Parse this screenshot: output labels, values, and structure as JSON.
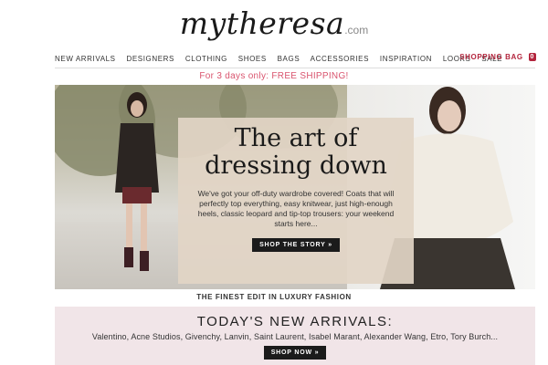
{
  "header": {
    "logo_text": "mytheresa",
    "logo_suffix": ".com"
  },
  "nav": {
    "items": [
      {
        "label": "NEW ARRIVALS"
      },
      {
        "label": "DESIGNERS"
      },
      {
        "label": "CLOTHING"
      },
      {
        "label": "SHOES"
      },
      {
        "label": "BAGS"
      },
      {
        "label": "ACCESSORIES"
      },
      {
        "label": "INSPIRATION"
      },
      {
        "label": "LOOKS"
      },
      {
        "label": "SALE"
      }
    ],
    "bag_label": "SHOPPING BAG",
    "bag_count": "0"
  },
  "promo": {
    "text": "For 3 days only: FREE SHIPPING!"
  },
  "hero": {
    "title_line1": "The art of",
    "title_line2": "dressing down",
    "body": "We've got your off-duty wardrobe covered! Coats that will perfectly top everything, easy knitwear, just high-enough heels, classic leopard and tip-top trousers: your weekend starts here...",
    "cta_label": "SHOP THE STORY »"
  },
  "tagline": "THE FINEST EDIT IN LUXURY FASHION",
  "arrivals": {
    "title": "TODAY'S NEW ARRIVALS:",
    "brands": "Valentino, Acne Studios, Givenchy, Lanvin, Saint Laurent, Isabel Marant, Alexander Wang, Etro, Tory Burch...",
    "cta_label": "SHOP NOW »"
  },
  "colors": {
    "accent": "#b3253d",
    "promo": "#d9546e",
    "arrivals_bg": "#f1e5e8",
    "button_bg": "#1b1b1b"
  }
}
